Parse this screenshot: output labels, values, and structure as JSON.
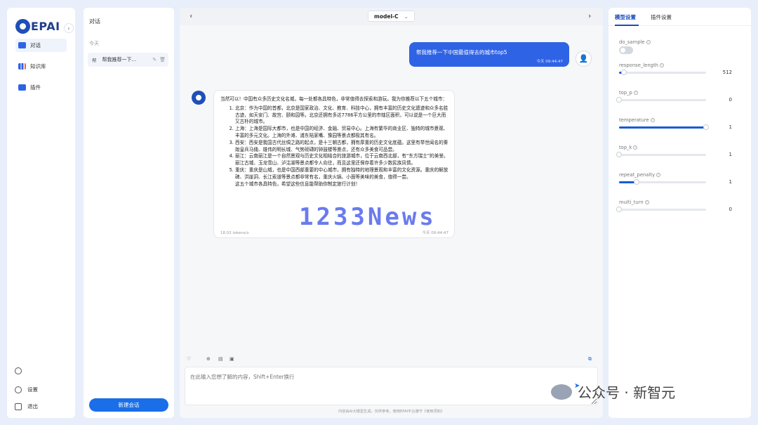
{
  "nav": {
    "logo_text": "EPAI",
    "items": [
      {
        "label": "对话",
        "icon": "chat-icon",
        "active": true
      },
      {
        "label": "知识库",
        "icon": "book-icon",
        "active": false
      },
      {
        "label": "插件",
        "icon": "plugin-icon",
        "active": false
      }
    ],
    "settings_label": "设置",
    "logout_label": "退出"
  },
  "conversations": {
    "title": "对话",
    "group_label": "今天",
    "item_tag": "帮",
    "item_text": "帮我推荐一下...",
    "new_button": "新建会话"
  },
  "chat": {
    "model_name": "model-C",
    "user_message": "帮我推荐一下中国最值得去的城市top5",
    "user_time": "今天 09:44:47",
    "bot_intro": "当然可以！中国有众多历史文化名城，每一处都各具特色，非常值得去探索和游玩。我为你推荐以下五个城市：",
    "bot_items": [
      "北京：作为中国的首都，北京是国家政治、文化、教育、科技中心，拥有丰富的历史文化遗迹和众多名胜古迹，如天安门、故宫、颐和园等。北京还拥有多达7786平方公里的市辖区面积，可以说是一个巨大而又古朴的城市。",
      "上海：上海是国际大都市，也是中国的经济、金融、贸易中心。上海有繁华的商业区、独特的城市景观、丰富的多元文化。上海的外滩、浦东陆家嘴、豫园等景点都极其有名。",
      "西安：西安是我国古代丝绸之路的起点，是十三朝古都，拥有厚重的历史文化底蕴。这里有举世闻名的秦始皇兵马俑、雄伟的明长城、气势磅礴的钟鼓楼等景点，还有众多美食可品尝。",
      "丽江：云南丽江是一个自然景观与历史文化相结合的旅游城市，位于云南西北部，有“东方瑞士”的美誉。丽江古城、玉龙雪山、泸沽湖等景点都令人向往，而且这里还保存着许多少数民族风情。",
      "重庆：重庆是山城，也是中国西部重要的中心城市，拥有独特的地理景观和丰富的文化资源。重庆的解放碑、洪崖洞、长江索道等景点都非常有名，重庆火锅、小面等美味的美食，值得一尝。"
    ],
    "bot_outro": "这五个城市各具特色，希望这些信息能帮助你制定旅行计划！",
    "bot_speed": "18.02 tokens/s",
    "bot_time": "今天 09:44:47",
    "watermark": "1233News",
    "input_placeholder": "在此输入您想了解的内容，Shift+Enter换行",
    "disclaimer": "内容由AI大模型生成，仅供参考。使用EPAI平台遵守《使用须知》",
    "corner_watermark": "公众号 · 新智元"
  },
  "settings": {
    "tab_model": "模型设置",
    "tab_plugin": "插件设置",
    "params": [
      {
        "name": "do_sample",
        "kind": "toggle",
        "on": false
      },
      {
        "name": "response_length",
        "kind": "slider",
        "fraction": 0.06,
        "value": "512"
      },
      {
        "name": "top_p",
        "kind": "slider",
        "fraction": 0.0,
        "value": "0"
      },
      {
        "name": "temperature",
        "kind": "slider",
        "fraction": 1.0,
        "value": "1"
      },
      {
        "name": "top_k",
        "kind": "slider",
        "fraction": 0.0,
        "value": "1"
      },
      {
        "name": "repeat_penalty",
        "kind": "slider",
        "fraction": 0.2,
        "value": "1"
      },
      {
        "name": "multi_turn",
        "kind": "slider",
        "fraction": 0.0,
        "value": "0"
      }
    ]
  },
  "colors": {
    "accent": "#1a6ee8",
    "user_bubble": "#2f63e6",
    "brand": "#1f4fb8"
  }
}
